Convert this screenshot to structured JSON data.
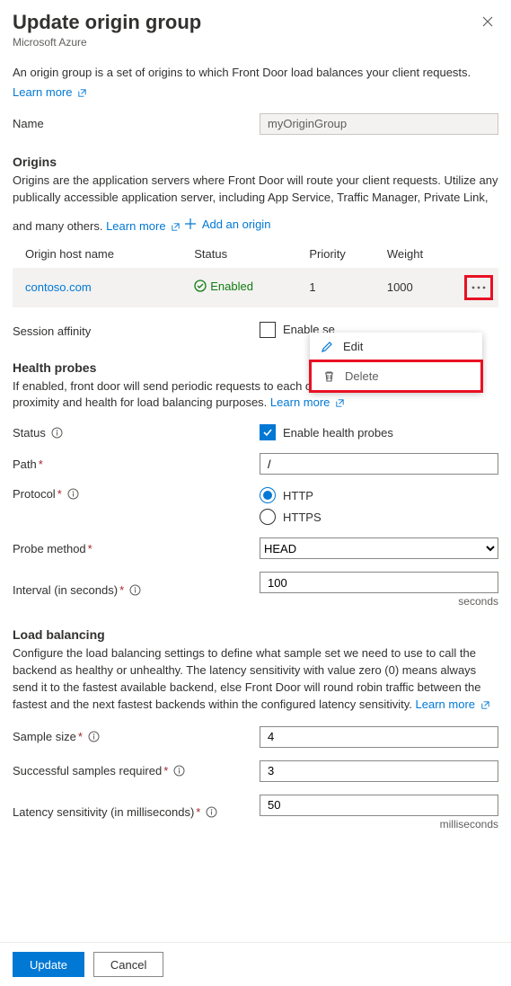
{
  "header": {
    "title": "Update origin group",
    "brand": "Microsoft Azure"
  },
  "intro": {
    "text": "An origin group is a set of origins to which Front Door load balances your client requests.",
    "learn_more": "Learn more"
  },
  "fields": {
    "name_label": "Name",
    "name_value": "myOriginGroup"
  },
  "origins": {
    "title": "Origins",
    "desc": "Origins are the application servers where Front Door will route your client requests. Utilize any publically accessible application server, including App Service, Traffic Manager, Private Link, and many others.",
    "learn_more": "Learn more",
    "add_label": "Add an origin",
    "cols": {
      "host": "Origin host name",
      "status": "Status",
      "priority": "Priority",
      "weight": "Weight"
    },
    "rows": [
      {
        "host": "contoso.com",
        "status": "Enabled",
        "priority": "1",
        "weight": "1000"
      }
    ]
  },
  "context_menu": {
    "edit": "Edit",
    "delete": "Delete"
  },
  "session_affinity": {
    "label": "Session affinity",
    "checkbox": "Enable se"
  },
  "health": {
    "title": "Health probes",
    "desc": "If enabled, front door will send periodic requests to each of your origins to determine their proximity and health for load balancing purposes.",
    "learn_more": "Learn more",
    "status_label": "Status",
    "enable_label": "Enable health probes",
    "path_label": "Path",
    "path_value": "/",
    "protocol_label": "Protocol",
    "protocol_http": "HTTP",
    "protocol_https": "HTTPS",
    "probe_method_label": "Probe method",
    "probe_method_value": "HEAD",
    "interval_label": "Interval (in seconds)",
    "interval_value": "100",
    "interval_unit": "seconds"
  },
  "lb": {
    "title": "Load balancing",
    "desc": "Configure the load balancing settings to define what sample set we need to use to call the backend as healthy or unhealthy. The latency sensitivity with value zero (0) means always send it to the fastest available backend, else Front Door will round robin traffic between the fastest and the next fastest backends within the configured latency sensitivity.",
    "learn_more": "Learn more",
    "sample_label": "Sample size",
    "sample_value": "4",
    "success_label": "Successful samples required",
    "success_value": "3",
    "latency_label": "Latency sensitivity (in milliseconds)",
    "latency_value": "50",
    "latency_unit": "milliseconds"
  },
  "footer": {
    "update": "Update",
    "cancel": "Cancel"
  }
}
